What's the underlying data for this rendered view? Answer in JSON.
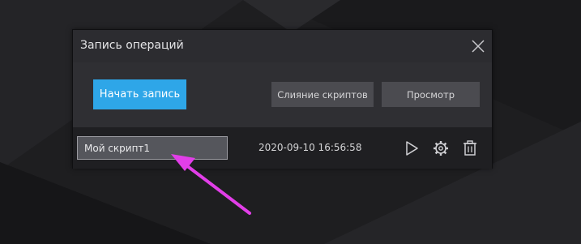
{
  "dialog": {
    "title": "Запись операций",
    "start_label": "Начать запись",
    "merge_label": "Слияние скриптов",
    "view_label": "Просмотр"
  },
  "script_row": {
    "name_value": "Мой скрипт1",
    "timestamp": "2020-09-10 16:56:58"
  },
  "icons": {
    "close": "close-icon",
    "play": "play-icon",
    "settings": "gear-icon",
    "delete": "trash-icon"
  },
  "colors": {
    "accent": "#2ea6e8",
    "annotation_arrow": "#e23ee8"
  }
}
